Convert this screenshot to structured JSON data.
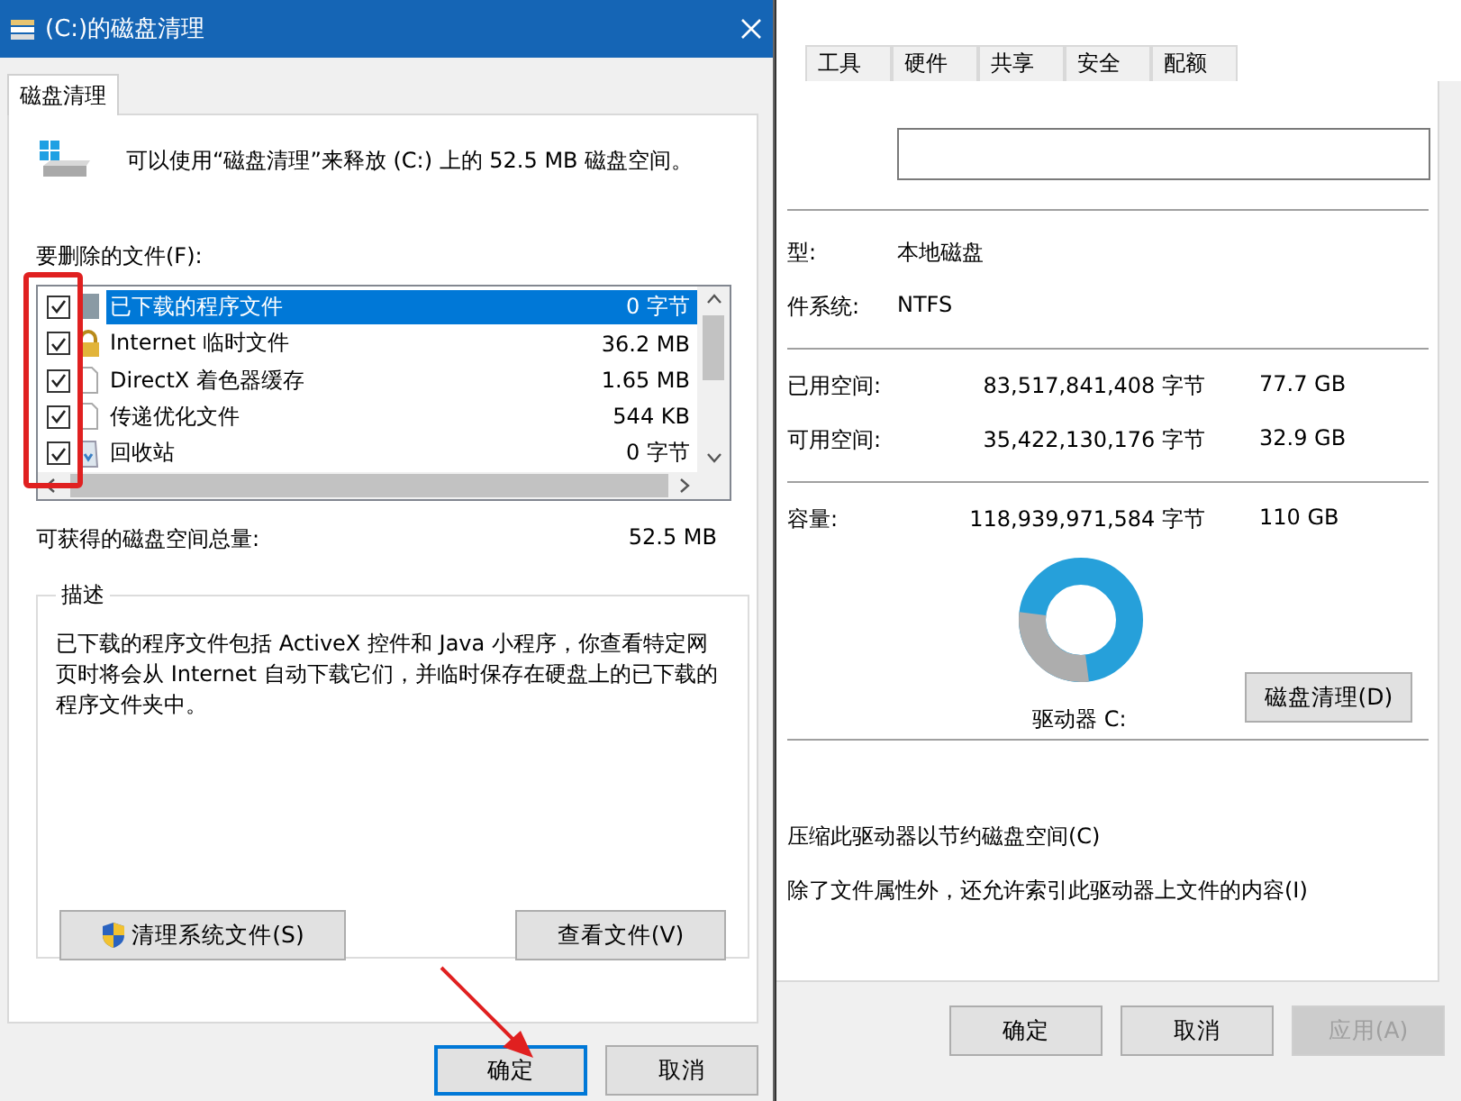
{
  "cleanup_dialog": {
    "title": "(C:)的磁盘清理",
    "tabs": [
      {
        "label": "磁盘清理",
        "selected": true
      }
    ],
    "intro": "可以使用“磁盘清理”来释放 (C:) 上的 52.5 MB 磁盘空间。",
    "files_label": "要删除的文件(F):",
    "files": [
      {
        "kind": "folder",
        "name": "已下载的程序文件",
        "size": "0 字节",
        "checked": true,
        "selected": true
      },
      {
        "kind": "lock",
        "name": "Internet 临时文件",
        "size": "36.2 MB",
        "checked": true,
        "selected": false
      },
      {
        "kind": "page",
        "name": "DirectX 着色器缓存",
        "size": "1.65 MB",
        "checked": true,
        "selected": false
      },
      {
        "kind": "page",
        "name": "传递优化文件",
        "size": "544 KB",
        "checked": true,
        "selected": false
      },
      {
        "kind": "bin",
        "name": "回收站",
        "size": "0 字节",
        "checked": true,
        "selected": false
      }
    ],
    "total_label": "可获得的磁盘空间总量:",
    "total": "52.5 MB",
    "description_title": "描述",
    "description": "已下载的程序文件包括 ActiveX 控件和 Java 小程序，你查看特定网页时将会从 Internet 自动下载它们，并临时保存在硬盘上的已下载的程序文件夹中。",
    "actions": [
      {
        "kind": "shield",
        "label": "清理系统文件(S)"
      },
      {
        "kind": "plain",
        "label": "查看文件(V)"
      }
    ],
    "buttons": [
      {
        "label": "确定",
        "default": true
      },
      {
        "label": "取消",
        "default": false
      }
    ]
  },
  "properties_window": {
    "tabs": [
      {
        "label": "工具",
        "selected": false
      },
      {
        "label": "硬件",
        "selected": false
      },
      {
        "label": "共享",
        "selected": false
      },
      {
        "label": "安全",
        "selected": false
      },
      {
        "label": "配额",
        "selected": false
      }
    ],
    "info": [
      {
        "label": "型:",
        "value": "本地磁盘"
      },
      {
        "label": "件系统:",
        "value": "NTFS"
      }
    ],
    "space": [
      {
        "label": "已用空间:",
        "bytes": "83,517,841,408 字节",
        "size": "77.7 GB"
      },
      {
        "label": "可用空间:",
        "bytes": "35,422,130,176 字节",
        "size": "32.9 GB"
      }
    ],
    "capacity": {
      "label": "容量:",
      "bytes": "118,939,971,584 字节",
      "size": "110 GB"
    },
    "drive_label": "驱动器 C:",
    "cleanup_button": "磁盘清理(D)",
    "options": [
      "压缩此驱动器以节约磁盘空间(C)",
      "除了文件属性外，还允许索引此驱动器上文件的内容(I)"
    ],
    "buttons": [
      {
        "label": "确定",
        "disabled": false
      },
      {
        "label": "取消",
        "disabled": false
      },
      {
        "label": "应用(A)",
        "disabled": true
      }
    ]
  },
  "annotations": [
    {
      "kind": "box"
    },
    {
      "kind": "arrow"
    }
  ]
}
